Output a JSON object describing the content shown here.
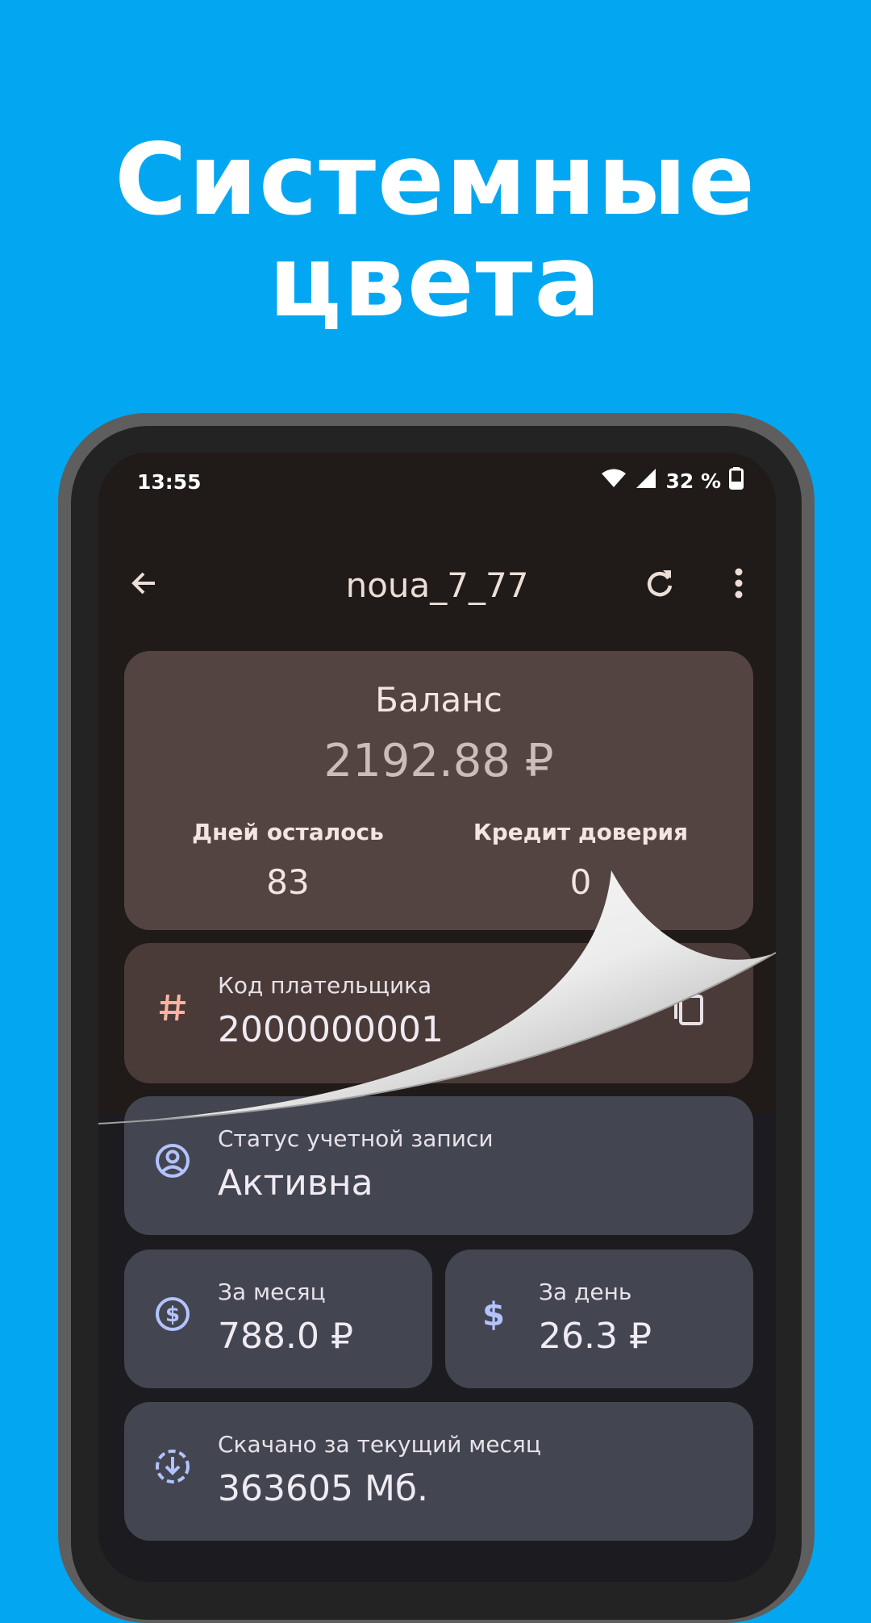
{
  "headline": {
    "line1": "Системные",
    "line2": "цвета"
  },
  "status_bar": {
    "time": "13:55",
    "battery": "32 %"
  },
  "app_bar": {
    "title": "noua_7_77"
  },
  "balance": {
    "label": "Баланс",
    "value": "2192.88 ₽",
    "days_label": "Дней осталось",
    "days_value": "83",
    "credit_label": "Кредит доверия",
    "credit_value": "0"
  },
  "payer": {
    "label": "Код плательщика",
    "value": "2000000001"
  },
  "account_status": {
    "label": "Статус учетной записи",
    "value": "Активна"
  },
  "month": {
    "label": "За месяц",
    "value": "788.0 ₽"
  },
  "day": {
    "label": "За день",
    "value": "26.3 ₽"
  },
  "download": {
    "label": "Скачано за текущий месяц",
    "value": "363605 Мб."
  },
  "icons": [
    "arrow-back-icon",
    "refresh-icon",
    "more-vert-icon",
    "hash-icon",
    "copy-icon",
    "account-circle-icon",
    "dollar-circle-icon",
    "dollar-icon",
    "download-icon",
    "wifi-icon",
    "signal-icon",
    "battery-icon"
  ],
  "colors": {
    "background": "#03A7F1",
    "balance_card": "#544441",
    "info_card": "#434650",
    "icon_tint": "#b3c3ff",
    "hash_tint": "#ffb3a4"
  }
}
